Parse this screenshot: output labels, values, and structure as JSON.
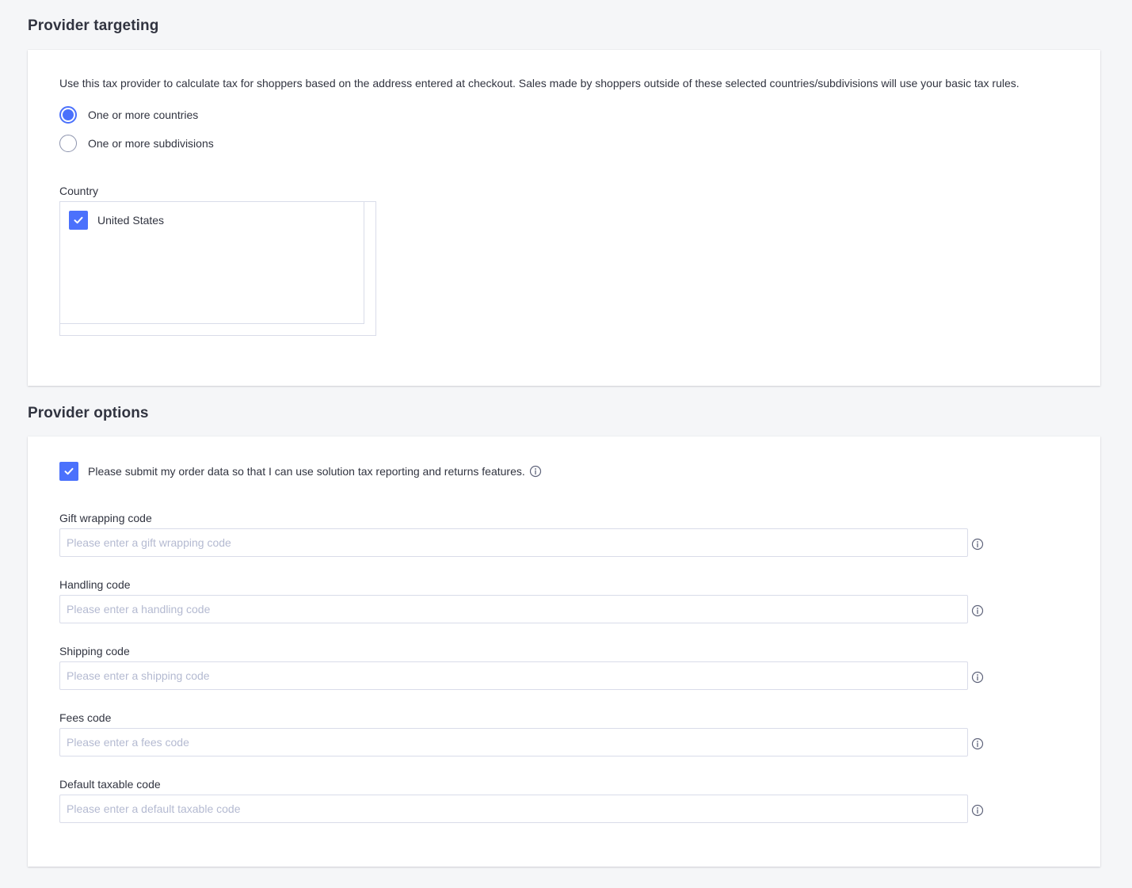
{
  "targeting": {
    "title": "Provider targeting",
    "description": "Use this tax provider to calculate tax for shoppers based on the address entered at checkout. Sales made by shoppers outside of these selected countries/subdivisions will use your basic tax rules.",
    "radio_options": [
      {
        "label": "One or more countries",
        "checked": true
      },
      {
        "label": "One or more subdivisions",
        "checked": false
      }
    ],
    "country_label": "Country",
    "countries": [
      {
        "label": "United States",
        "checked": true
      }
    ]
  },
  "options": {
    "title": "Provider options",
    "submit_checkbox": {
      "label": "Please submit my order data so that I can use solution tax reporting and returns features.",
      "checked": true
    },
    "fields": [
      {
        "label": "Gift wrapping code",
        "placeholder": "Please enter a gift wrapping code",
        "value": ""
      },
      {
        "label": "Handling code",
        "placeholder": "Please enter a handling code",
        "value": ""
      },
      {
        "label": "Shipping code",
        "placeholder": "Please enter a shipping code",
        "value": ""
      },
      {
        "label": "Fees code",
        "placeholder": "Please enter a fees code",
        "value": ""
      },
      {
        "label": "Default taxable code",
        "placeholder": "Please enter a default taxable code",
        "value": ""
      }
    ]
  },
  "colors": {
    "accent": "#4b71fc",
    "background": "#f5f6f8",
    "panel": "#ffffff",
    "text": "#313440",
    "border": "#d9dce9",
    "placeholder": "#b4bad1"
  }
}
